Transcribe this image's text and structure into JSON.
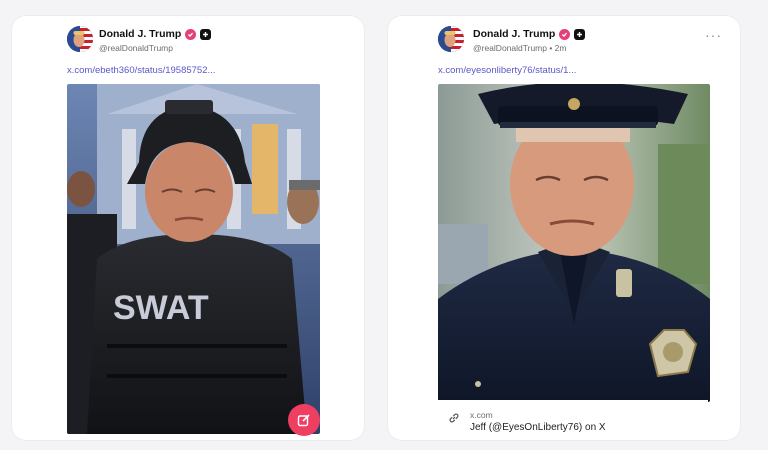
{
  "posts": [
    {
      "author_name": "Donald J. Trump",
      "handle": "@realDonaldTrump",
      "link": "x.com/ebeth360/status/19585752...",
      "image_text": "SWAT",
      "icons": [
        "avatar-flag-icon",
        "verified-badge-icon",
        "plus-badge-icon"
      ]
    },
    {
      "author_name": "Donald J. Trump",
      "handle": "@realDonaldTrump • 2m",
      "link": "x.com/eyesonliberty76/status/1...",
      "more_menu": "···",
      "link_card": {
        "domain": "x.com",
        "title": "Jeff (@EyesOnLiberty76) on X"
      },
      "icons": [
        "avatar-flag-icon",
        "verified-badge-icon",
        "plus-badge-icon",
        "link-icon",
        "compose-icon"
      ]
    }
  ],
  "colors": {
    "background": "#f4f4f6",
    "card": "#ffffff",
    "link": "#5b57c9",
    "verified": "#e4407b",
    "fab": "#ee3f63"
  }
}
